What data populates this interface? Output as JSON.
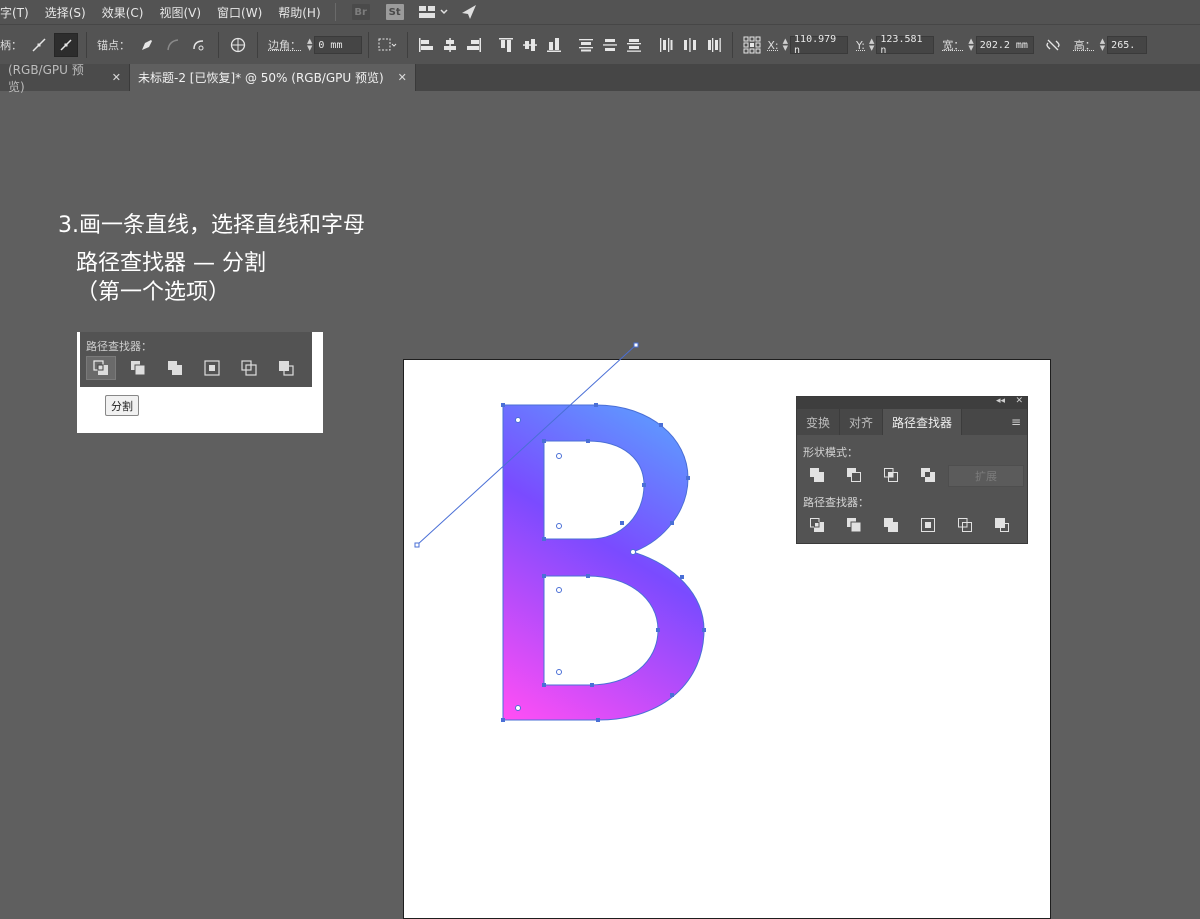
{
  "menu": {
    "items": [
      "字(T)",
      "选择(S)",
      "效果(C)",
      "视图(V)",
      "窗口(W)",
      "帮助(H)"
    ],
    "badges": [
      "Br",
      "St"
    ]
  },
  "control": {
    "handle_label": "柄：",
    "anchor_label": "锚点：",
    "corner_label": "边角：",
    "corner_value": "0 mm",
    "x_label": "X:",
    "x_value": "110.979 n",
    "y_label": "Y:",
    "y_value": "123.581 n",
    "w_label": "宽：",
    "w_value": "202.2 mm",
    "h_label": "高：",
    "h_value": "265."
  },
  "tabs": [
    {
      "label": "(RGB/GPU 预览)",
      "active": false
    },
    {
      "label": "未标题-2 [已恢复]* @ 50% (RGB/GPU 预览)",
      "active": true
    }
  ],
  "instructions": {
    "line1": "3.画一条直线，选择直线和字母",
    "line2": "路径查找器 — 分割",
    "line3": "（第一个选项）"
  },
  "inset": {
    "title": "路径查找器：",
    "divide_button": "分割"
  },
  "panel": {
    "tabs": [
      "变换",
      "对齐",
      "路径查找器"
    ],
    "active_tab": "路径查找器",
    "shape_modes_label": "形状模式：",
    "expand_button": "扩展",
    "pathfinders_label": "路径查找器："
  },
  "colors": {
    "gradient_start": "#ff4ef5",
    "gradient_mid": "#7a4bff",
    "gradient_end": "#5aa6ff",
    "selection_blue": "#4a6fd6"
  }
}
